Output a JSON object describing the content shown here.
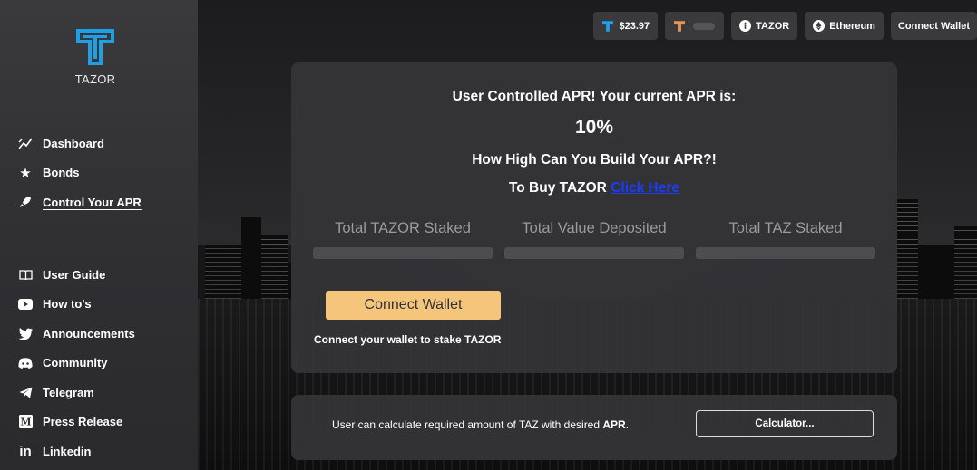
{
  "brand": {
    "name": "TAZOR",
    "logo_icon": "tazor-logo-icon"
  },
  "sidebar": {
    "primary": [
      {
        "label": "Dashboard",
        "icon": "chart-line-icon"
      },
      {
        "label": "Bonds",
        "icon": "star-icon"
      },
      {
        "label": "Control Your APR",
        "icon": "rocket-icon",
        "active": true
      }
    ],
    "secondary": [
      {
        "label": "User Guide",
        "icon": "book-icon"
      },
      {
        "label": "How to's",
        "icon": "youtube-icon"
      },
      {
        "label": "Announcements",
        "icon": "twitter-icon"
      },
      {
        "label": "Community",
        "icon": "discord-icon"
      },
      {
        "label": "Telegram",
        "icon": "telegram-icon"
      },
      {
        "label": "Press Release",
        "icon": "medium-icon"
      },
      {
        "label": "Linkedin",
        "icon": "linkedin-icon"
      }
    ]
  },
  "topbar": {
    "price": "$23.97",
    "token_label": "TAZOR",
    "network_label": "Ethereum",
    "connect_label": "Connect Wallet"
  },
  "main": {
    "heading": "User Controlled APR! Your current APR is:",
    "apr_value": "10%",
    "subheading": "How High Can You Build Your APR?!",
    "buy_text": "To Buy TAZOR",
    "buy_link": "Click Here",
    "stats": [
      {
        "label": "Total TAZOR Staked"
      },
      {
        "label": "Total Value Deposited"
      },
      {
        "label": "Total TAZ Staked"
      }
    ],
    "connect_button": "Connect Wallet",
    "connect_note": "Connect your wallet to stake TAZOR"
  },
  "calculator": {
    "text": "User can calculate required amount of TAZ with desired",
    "text_bold": "APR",
    "text_end": ".",
    "button": "Calculator..."
  },
  "colors": {
    "accent_button": "#f5c57c",
    "link": "#1a3cff",
    "logo_blue": "#1fa0e6"
  }
}
